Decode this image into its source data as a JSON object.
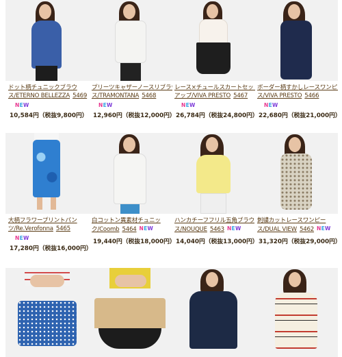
{
  "new_badge": [
    "N",
    "E",
    "W"
  ],
  "products": [
    {
      "line1": "ドット柄チュニックブラウ",
      "line2": "ス/ETERNO BELLEZZA",
      "code": "5469",
      "price": "10,584円（税抜9,800円）",
      "new": true,
      "garment_color": "#3a5fa8",
      "bottom_color": "#1d1d1d"
    },
    {
      "line1": "プリーツキャザーノースリブラウ",
      "line2": "ス/TRAMONTANA",
      "code": "5468",
      "price": "12,960円（税抜12,000円）",
      "new": true,
      "garment_color": "#f4f4f2",
      "bottom_color": "#222222"
    },
    {
      "line1": "レース×チュールスカートセット",
      "line2": "アップ/VIVA PRESTO",
      "code": "5467",
      "price": "26,784円（税抜24,800円）",
      "new": true,
      "garment_color": "#f7f2ec",
      "bottom_color": "#1e1e1e"
    },
    {
      "line1": "ボーダー柄すかしレースワンピー",
      "line2": "ス/VIVA PRESTO",
      "code": "5466",
      "price": "22,680円（税抜21,000円）",
      "new": true,
      "garment_color": "#1f2b4d",
      "bottom_color": "#1f2b4d"
    },
    {
      "line1": "大柄フラワープリントパン",
      "line2": "ツ/Re.Verofonna",
      "code": "5465",
      "price": "17,280円（税抜16,000円）",
      "new": true,
      "garment_color": "#f6f6f6",
      "bottom_color": "#2f7fd0"
    },
    {
      "line1": "白コットン異素材チュニッ",
      "line2": "ク/Coomb",
      "code": "5464",
      "price": "19,440円（税抜18,000円）",
      "new": true,
      "garment_color": "#f5f5f3",
      "bottom_color": "#3d8fc9"
    },
    {
      "line1": "ハンカチーフフリル五角ブラウ",
      "line2": "ス/NOUQUE",
      "code": "5463",
      "price": "14,040円（税抜13,000円）",
      "new": true,
      "garment_color": "#f3e98a",
      "bottom_color": "#efefef"
    },
    {
      "line1": "刺繍カットレースワンピー",
      "line2": "ス/DUAL VIEW",
      "code": "5462",
      "price": "31,320円（税抜29,000円）",
      "new": true,
      "garment_color": "#d9d3c3",
      "bottom_color": "#d9d3c3"
    },
    {
      "garment_color": "#2e63b0",
      "bottom_color": "#2e63b0"
    },
    {
      "garment_color": "#d7b98a",
      "bottom_color": "#1c1c1c"
    },
    {
      "garment_color": "#1d2a45",
      "bottom_color": "#1d2a45"
    },
    {
      "garment_color": "#f5efe1",
      "bottom_color": "#f5efe1"
    }
  ]
}
